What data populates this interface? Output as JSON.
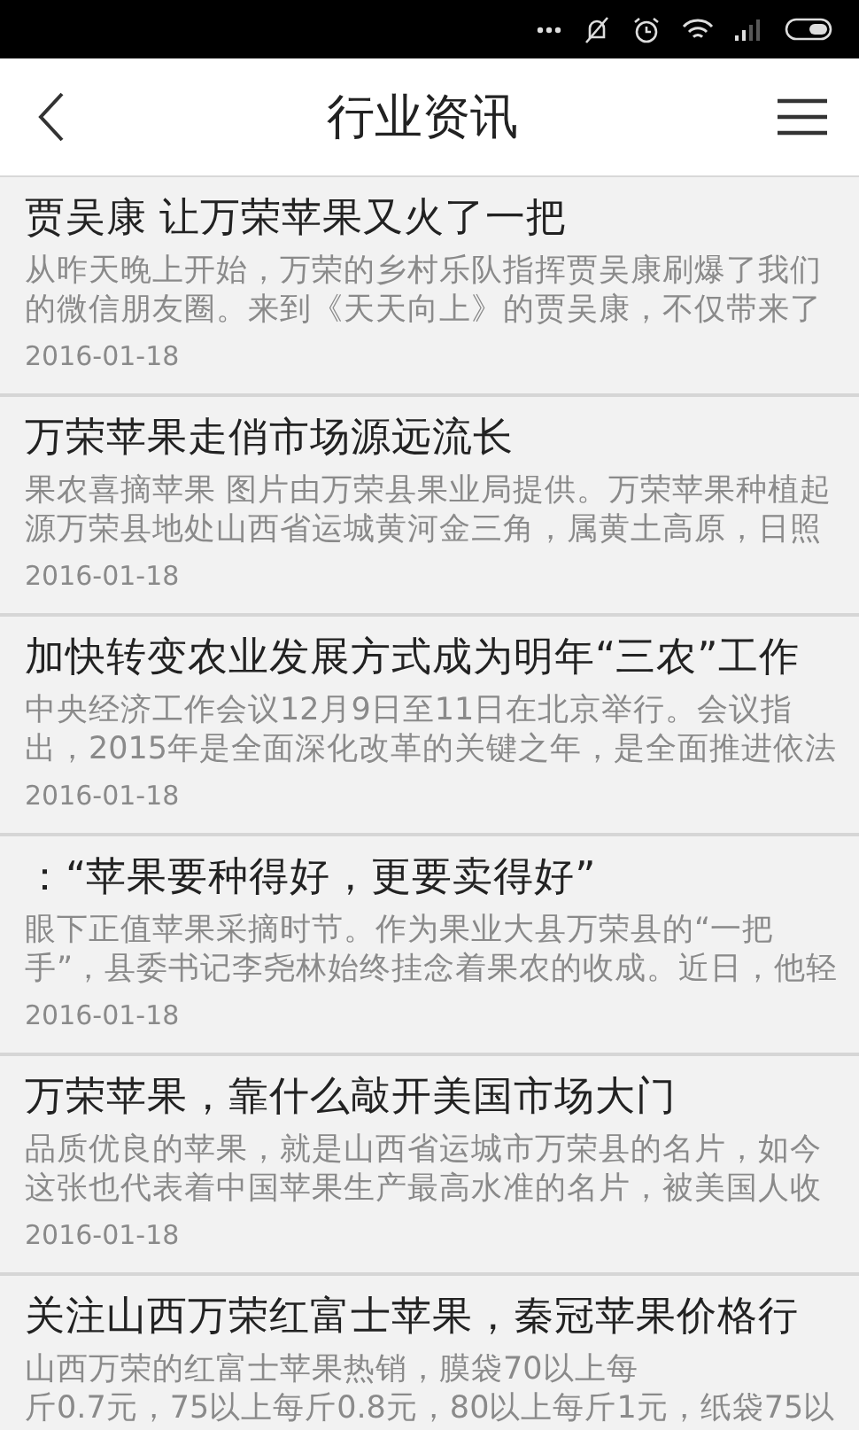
{
  "header": {
    "title": "行业资讯"
  },
  "news": [
    {
      "title": "贾吴康 让万荣苹果又火了一把",
      "snippet": [
        "从昨天晚上开始，万荣的乡村乐队指挥贾吴康刷爆了我们",
        "的微信朋友圈。来到《天天向上》的贾吴康，不仅带来了"
      ],
      "date": "2016-01-18"
    },
    {
      "title": "万荣苹果走俏市场源远流长",
      "snippet": [
        "果农喜摘苹果 图片由万荣县果业局提供。万荣苹果种植起",
        "源万荣县地处山西省运城黄河金三角，属黄土高原，日照"
      ],
      "date": "2016-01-18"
    },
    {
      "title": "加快转变农业发展方式成为明年“三农”工作",
      "snippet": [
        "中央经济工作会议12月9日至11日在北京举行。会议指",
        "出，2015年是全面深化改革的关键之年，是全面推进依法"
      ],
      "date": "2016-01-18"
    },
    {
      "title": "：“苹果要种得好，更要卖得好”",
      "snippet": [
        "眼下正值苹果采摘时节。作为果业大县万荣县的“一把",
        "手”，县委书记李尧林始终挂念着果农的收成。近日，他轻"
      ],
      "date": "2016-01-18"
    },
    {
      "title": "万荣苹果，靠什么敲开美国市场大门",
      "snippet": [
        "品质优良的苹果，就是山西省运城市万荣县的名片，如今",
        "这张也代表着中国苹果生产最高水准的名片，被美国人收"
      ],
      "date": "2016-01-18"
    },
    {
      "title": "关注山西万荣红富士苹果，秦冠苹果价格行",
      "snippet": [
        "山西万荣的红富士苹果热销，膜袋70以上每",
        "斤0.7元，75以上每斤0.8元，80以上每斤1元，纸袋75以"
      ]
    }
  ]
}
